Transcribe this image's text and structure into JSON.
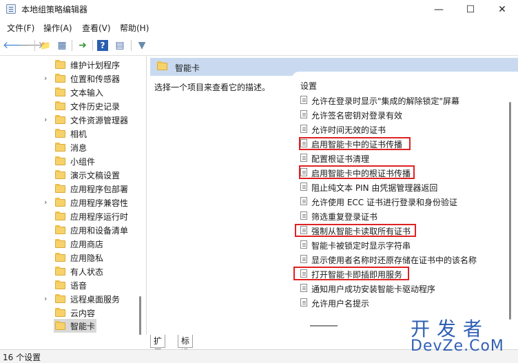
{
  "window": {
    "title": "本地组策略编辑器",
    "minimize": "—",
    "maximize": "☐",
    "close": "✕"
  },
  "menu": [
    "文件(F)",
    "操作(A)",
    "查看(V)",
    "帮助(H)"
  ],
  "toolbar": {
    "back": "🡐",
    "forward": "🡒",
    "up": "📁",
    "show_hide": "▦",
    "export": "➜",
    "help": "?",
    "properties": "▤",
    "filter": "▼"
  },
  "tree": {
    "items": [
      {
        "label": "维护计划程序",
        "expandable": false
      },
      {
        "label": "位置和传感器",
        "expandable": true
      },
      {
        "label": "文本输入",
        "expandable": false
      },
      {
        "label": "文件历史记录",
        "expandable": false
      },
      {
        "label": "文件资源管理器",
        "expandable": true
      },
      {
        "label": "相机",
        "expandable": false
      },
      {
        "label": "消息",
        "expandable": false
      },
      {
        "label": "小组件",
        "expandable": false
      },
      {
        "label": "演示文稿设置",
        "expandable": false
      },
      {
        "label": "应用程序包部署",
        "expandable": false
      },
      {
        "label": "应用程序兼容性",
        "expandable": true
      },
      {
        "label": "应用程序运行时",
        "expandable": false
      },
      {
        "label": "应用和设备清单",
        "expandable": false
      },
      {
        "label": "应用商店",
        "expandable": false
      },
      {
        "label": "应用隐私",
        "expandable": false
      },
      {
        "label": "有人状态",
        "expandable": false
      },
      {
        "label": "语音",
        "expandable": false
      },
      {
        "label": "远程桌面服务",
        "expandable": true
      },
      {
        "label": "云内容",
        "expandable": false
      },
      {
        "label": "智能卡",
        "expandable": false,
        "selected": true
      }
    ],
    "chevron": "›"
  },
  "content": {
    "header": "智能卡",
    "description": "选择一个项目来查看它的描述。",
    "list_header": "设置",
    "settings": [
      {
        "label": "允许在登录时显示\"集成的解除锁定\"屏幕",
        "highlighted": false
      },
      {
        "label": "允许签名密钥对登录有效",
        "highlighted": false
      },
      {
        "label": "允许时间无效的证书",
        "highlighted": false
      },
      {
        "label": "启用智能卡中的证书传播",
        "highlighted": true
      },
      {
        "label": "配置根证书清理",
        "highlighted": false
      },
      {
        "label": "启用智能卡中的根证书传播",
        "highlighted": true
      },
      {
        "label": "阻止纯文本 PIN 由凭据管理器返回",
        "highlighted": false
      },
      {
        "label": "允许使用 ECC 证书进行登录和身份验证",
        "highlighted": false
      },
      {
        "label": "筛选重复登录证书",
        "highlighted": false
      },
      {
        "label": "强制从智能卡读取所有证书",
        "highlighted": true
      },
      {
        "label": "智能卡被锁定时显示字符串",
        "highlighted": false
      },
      {
        "label": "显示使用者名称时还原存储在证书中的该名称",
        "highlighted": false
      },
      {
        "label": "打开智能卡即插即用服务",
        "highlighted": true
      },
      {
        "label": "通知用户成功安装智能卡驱动程序",
        "highlighted": false
      },
      {
        "label": "允许用户名提示",
        "highlighted": false
      }
    ]
  },
  "tabs": [
    "扩展",
    "标准"
  ],
  "status": "16 个设置",
  "watermark": {
    "line1": "开发者",
    "line2": "DevZe.CoM"
  },
  "colors": {
    "highlight_box": "#e02020",
    "header_bg": "#c9daf0",
    "watermark": "#2f5fb4"
  }
}
